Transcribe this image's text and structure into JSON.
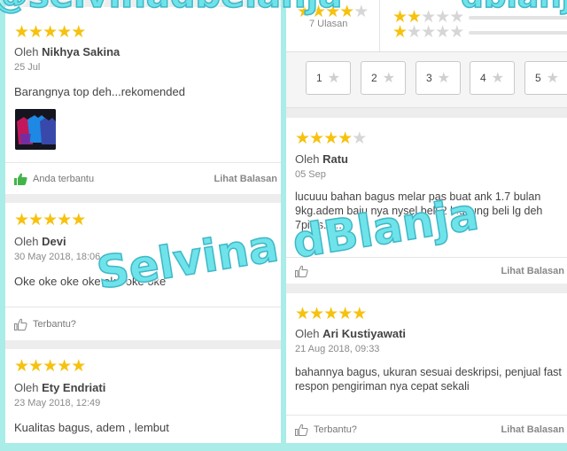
{
  "left_reviews": [
    {
      "rating": 5,
      "by_prefix": "Oleh",
      "author": "Nikhya Sakina",
      "date": "25 Jul",
      "text": "Barangnya top deh...rekomended",
      "helpful": "Anda terbantu",
      "helpful_active": true,
      "reply": "Lihat Balasan"
    },
    {
      "rating": 5,
      "by_prefix": "Oleh",
      "author": "Devi",
      "date": "30 May 2018, 18:06",
      "text": "Oke oke oke oke oke oke oke",
      "helpful": "Terbantu?",
      "helpful_active": false
    },
    {
      "rating": 5,
      "by_prefix": "Oleh",
      "author": "Ety Endriati",
      "date": "23 May 2018, 12:49",
      "text": "Kualitas bagus, adem , lembut"
    }
  ],
  "summary": {
    "count_label": "7 Ulasan",
    "rating": 4
  },
  "rating_bars": [
    {
      "stars": 2
    },
    {
      "stars": 1
    }
  ],
  "filter_chips": [
    "1",
    "2",
    "3",
    "4",
    "5"
  ],
  "right_reviews": [
    {
      "rating": 4,
      "by_prefix": "Oleh",
      "author": "Ratu",
      "date": "05 Sep",
      "text": "lucuuu bahan bagus melar pas buat ank 1.7 bulan 9kg.adem baju nya nysel beli 2 lngsung beli lg deh 7picis......",
      "reply": "Lihat Balasan"
    },
    {
      "rating": 5,
      "by_prefix": "Oleh",
      "author": "Ari Kustiyawati",
      "date": "21 Aug 2018, 09:33",
      "text": "bahannya bagus, ukuran sesuai deskripsi, penjual fast respon pengiriman nya cepat sekali",
      "helpful": "Terbantu?",
      "reply": "Lihat Balasan"
    }
  ],
  "watermarks": {
    "top_left": "@selvinadbelanja",
    "top_right": "dblanja",
    "center": "Selvina dBlanja"
  },
  "colors": {
    "star_on": "#f6c20f",
    "star_off": "#d6d6d6",
    "helpful_active": "#42b549",
    "background": "#a9ece8",
    "watermark": "#6fe3ea"
  },
  "icons": {
    "star": "star-icon",
    "thumb": "thumbs-up-icon"
  }
}
